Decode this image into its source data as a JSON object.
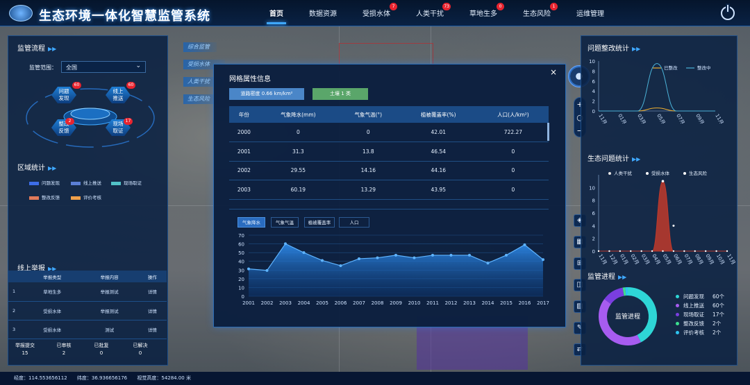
{
  "app": {
    "title": "生态环境一体化智慧监管系统"
  },
  "nav": [
    {
      "label": "首页",
      "active": true,
      "badge": ""
    },
    {
      "label": "数据资源",
      "active": false,
      "badge": ""
    },
    {
      "label": "受损水体",
      "active": false,
      "badge": "7"
    },
    {
      "label": "人类干扰",
      "active": false,
      "badge": "73"
    },
    {
      "label": "草地生多",
      "active": false,
      "badge": "0"
    },
    {
      "label": "生态风险",
      "active": false,
      "badge": "1"
    },
    {
      "label": "运维管理",
      "active": false,
      "badge": ""
    }
  ],
  "left": {
    "flow": {
      "title": "监管流程",
      "scope_label": "监管范围：",
      "scope_value": "全国",
      "nodes": [
        {
          "label": "问题\n发现",
          "badge": "60"
        },
        {
          "label": "线上\n推送",
          "badge": "60"
        },
        {
          "label": "整改\n反馈",
          "badge": "2"
        },
        {
          "label": "现场\n取证",
          "badge": "17"
        }
      ]
    },
    "region": {
      "title": "区域统计",
      "legend": [
        {
          "label": "问题发现",
          "color": "#3d6ee8"
        },
        {
          "label": "线上推送",
          "color": "#5b7fd6"
        },
        {
          "label": "现场取证",
          "color": "#52c2c8"
        },
        {
          "label": "整改反馈",
          "color": "#e07a5a"
        },
        {
          "label": "评价考核",
          "color": "#f0a04b"
        }
      ]
    },
    "report": {
      "title": "线上举报",
      "headers": [
        "举报类型",
        "举报内容",
        "操作"
      ],
      "rows": [
        [
          "1",
          "草地生多",
          "举报测试",
          "详情"
        ],
        [
          "2",
          "受损水体",
          "举报测试",
          "详情"
        ],
        [
          "3",
          "受损水体",
          "测试",
          "详情"
        ]
      ],
      "stats": [
        {
          "label": "举报提交",
          "value": "15"
        },
        {
          "label": "已审核",
          "value": "2"
        },
        {
          "label": "已批复",
          "value": "0"
        },
        {
          "label": "已解决",
          "value": "0"
        }
      ]
    }
  },
  "map_tabs": [
    "综合监管",
    "受损水体",
    "人类干扰",
    "生态风险"
  ],
  "modal": {
    "title": "网格属性信息",
    "close": "×",
    "chips": [
      {
        "label": "道路密度 0.66 km/km²",
        "color": "#4a86c8"
      },
      {
        "label": "土壤 1 类",
        "color": "#5aa66a"
      }
    ],
    "table": {
      "headers": [
        "年份",
        "气象降水(mm)",
        "气象气温(°)",
        "植被覆盖率(%)",
        "人口(人/km²)"
      ],
      "rows": [
        [
          "2000",
          "0",
          "0",
          "42.01",
          "722.27"
        ],
        [
          "2001",
          "31.3",
          "13.8",
          "46.54",
          "0"
        ],
        [
          "2002",
          "29.55",
          "14.16",
          "44.16",
          "0"
        ],
        [
          "2003",
          "60.19",
          "13.29",
          "43.95",
          "0"
        ]
      ]
    },
    "chart_tabs": [
      "气象降水",
      "气象气温",
      "植被覆盖率",
      "人口"
    ]
  },
  "chart_data": [
    {
      "id": "precip",
      "type": "area",
      "x": [
        "2001",
        "2002",
        "2003",
        "2004",
        "2005",
        "2006",
        "2007",
        "2008",
        "2009",
        "2010",
        "2011",
        "2012",
        "2013",
        "2014",
        "2015",
        "2016",
        "2017"
      ],
      "values": [
        31.3,
        29.55,
        60.19,
        50,
        41,
        35,
        43,
        44,
        47,
        44,
        47,
        47,
        47,
        38,
        47,
        59,
        42
      ],
      "ylim": [
        0,
        70
      ],
      "yticks": [
        0,
        10,
        20,
        30,
        40,
        50,
        60,
        70
      ]
    },
    {
      "id": "rectify",
      "type": "line",
      "title": "问题整改统计",
      "categories": [
        "11月",
        "01月",
        "03月",
        "05月",
        "07月",
        "09月",
        "11月"
      ],
      "series": [
        {
          "name": "已整改",
          "color": "#f0b030",
          "values": [
            0,
            0,
            0,
            0.6,
            0,
            0,
            0
          ]
        },
        {
          "name": "整改中",
          "color": "#4bb3d8",
          "values": [
            0,
            0,
            0,
            9.5,
            0,
            0,
            0
          ]
        }
      ],
      "ylim": [
        0,
        10
      ]
    },
    {
      "id": "eco",
      "type": "area",
      "title": "生态问题统计",
      "categories": [
        "11月",
        "12月",
        "01月",
        "02月",
        "03月",
        "04月",
        "05月",
        "06月",
        "07月",
        "08月",
        "09月",
        "10月",
        "11月"
      ],
      "series": [
        {
          "name": "人类干扰",
          "color": "#c0392b",
          "values": [
            0,
            0,
            0,
            0,
            0,
            0,
            11,
            0,
            0,
            0,
            0,
            0,
            0
          ]
        },
        {
          "name": "受损水体",
          "color": "#ffffff",
          "values": [
            0,
            0,
            0,
            0,
            0,
            0,
            4,
            0,
            0,
            0,
            0,
            0,
            0
          ]
        },
        {
          "name": "生态风险",
          "color": "#ffffff",
          "values": [
            0,
            0,
            0,
            0,
            0,
            0,
            0,
            0,
            0,
            0,
            0,
            0,
            0
          ]
        }
      ],
      "ylim": [
        0,
        12
      ]
    },
    {
      "id": "progress",
      "type": "pie",
      "title": "监管进程",
      "center": "监管进程",
      "slices": [
        {
          "label": "问题发现",
          "value": 60,
          "unit": "60个",
          "color": "#2ed6d6"
        },
        {
          "label": "线上推送",
          "value": 60,
          "unit": "60个",
          "color": "#a75cf0"
        },
        {
          "label": "现场取证",
          "value": 17,
          "unit": "17个",
          "color": "#7a3ee0"
        },
        {
          "label": "整改反馈",
          "value": 2,
          "unit": "2个",
          "color": "#3ce08f"
        },
        {
          "label": "评价考核",
          "value": 2,
          "unit": "2个",
          "color": "#2ec4f0"
        }
      ]
    }
  ],
  "right": {
    "rectify_title": "问题整改统计",
    "eco_title": "生态问题统计",
    "progress_title": "监管进程"
  },
  "status": {
    "lon": "经度：114.553656112",
    "lat": "纬度：36.936656176",
    "alt": "视觉高度：54284.00 米"
  }
}
